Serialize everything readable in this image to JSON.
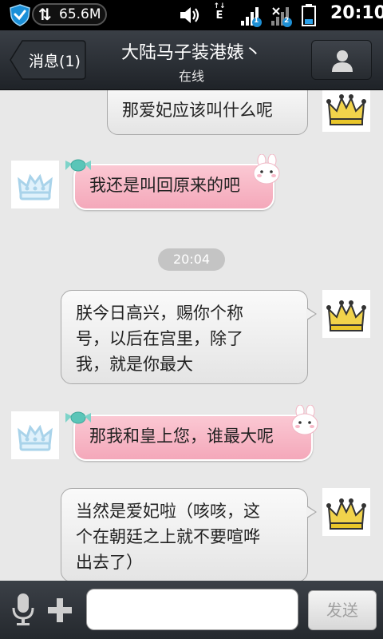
{
  "status_bar": {
    "net_speed": "65.6M",
    "network_type": "E",
    "sim1_badge": "1",
    "sim2_badge": "2",
    "time": "20:10"
  },
  "header": {
    "back_label": "消息(1)",
    "title": "大陆马子装港婊丶",
    "subtitle": "在线"
  },
  "messages": [
    {
      "sender": "me",
      "text": "那爱妃应该叫什么呢"
    },
    {
      "sender": "other",
      "text": "我还是叫回原来的吧"
    },
    {
      "type": "time",
      "text": "20:04"
    },
    {
      "sender": "me",
      "lines": [
        "朕今日高兴，赐你个称",
        "号，以后在宫里，除了",
        "我，就是你最大"
      ]
    },
    {
      "sender": "other",
      "text": "那我和皇上您，谁最大呢"
    },
    {
      "sender": "me",
      "lines": [
        "当然是爱妃啦（咳咳，这",
        "个在朝廷之上就不要喧哗",
        "出去了）"
      ]
    }
  ],
  "input_bar": {
    "input_value": "",
    "send_label": "发送"
  },
  "colors": {
    "title_bar": "#2b3036",
    "chat_background": "#e8e8e8",
    "pink_bubble": "#f6b3c3",
    "gold_crown": "#e9c62a",
    "blue_crown": "#a9d3ea"
  },
  "icons": [
    "shield-icon",
    "sync-icon",
    "volume-icon",
    "signal-icon",
    "battery-icon",
    "person-icon",
    "crown-icon",
    "candy-icon",
    "bunny-icon",
    "microphone-icon",
    "plus-icon"
  ]
}
